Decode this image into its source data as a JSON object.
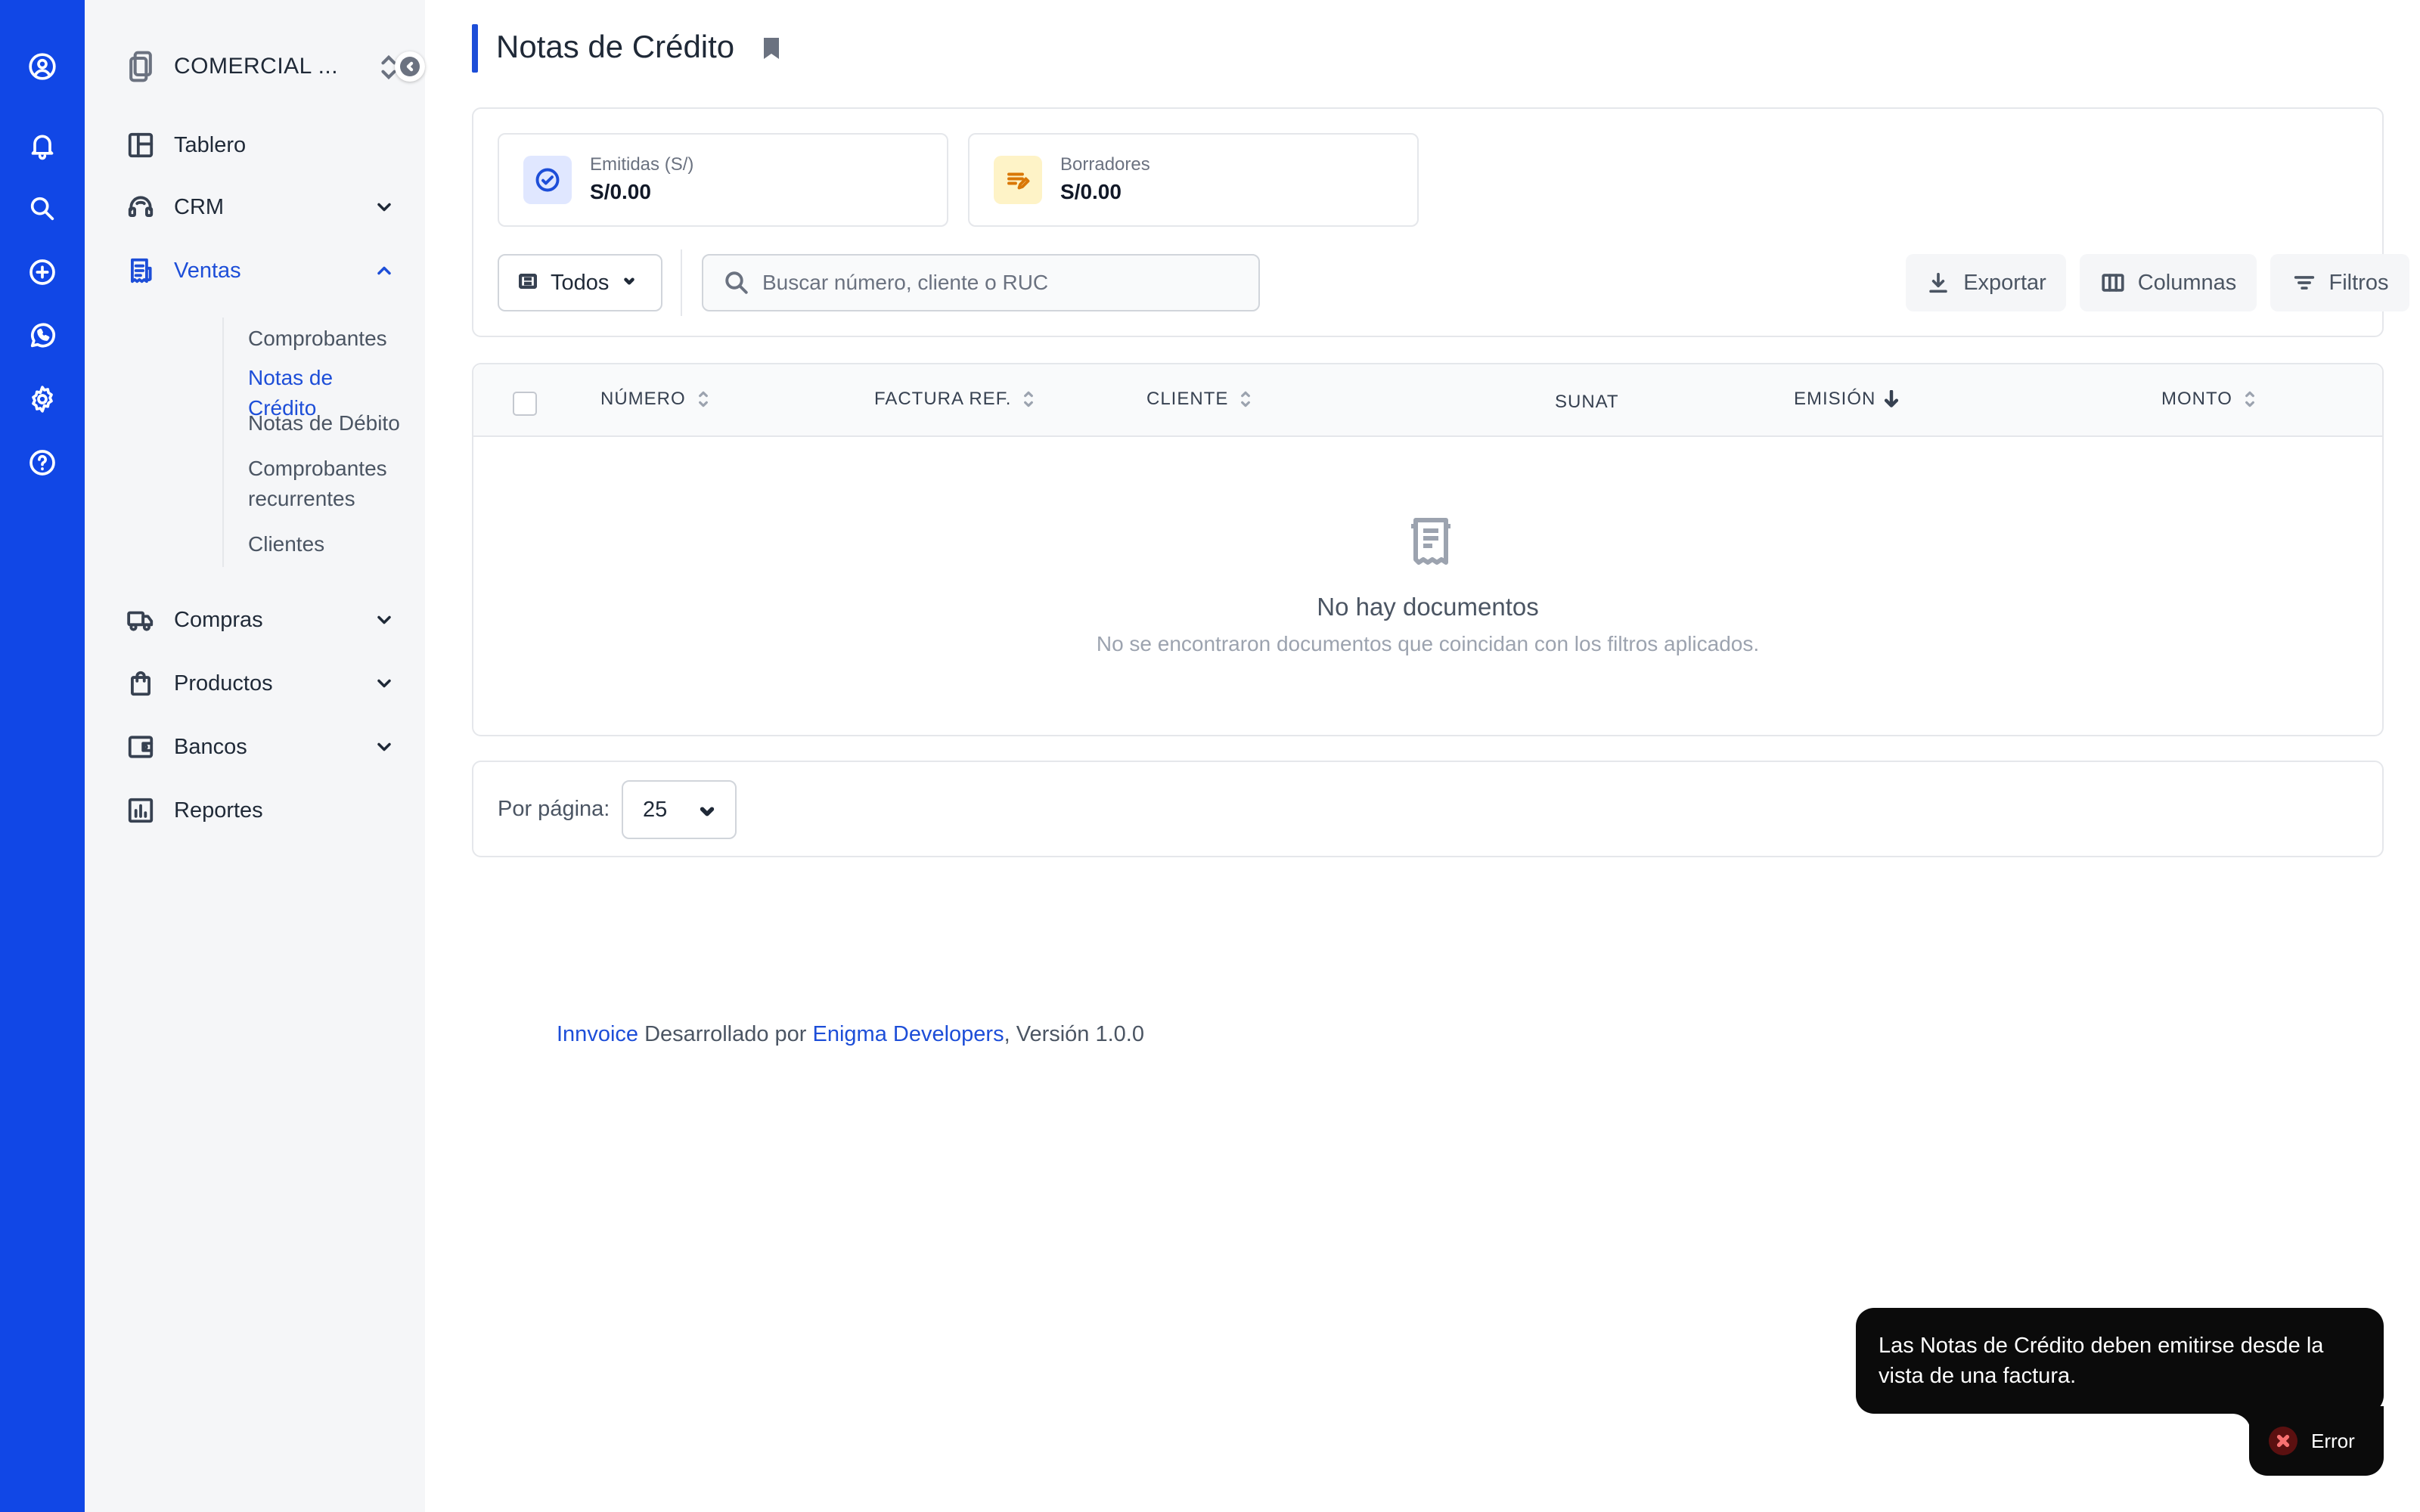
{
  "company": {
    "name": "COMERCIAL ..."
  },
  "nav": {
    "items": [
      {
        "label": "Tablero"
      },
      {
        "label": "CRM"
      },
      {
        "label": "Ventas"
      },
      {
        "label": "Compras"
      },
      {
        "label": "Productos"
      },
      {
        "label": "Bancos"
      },
      {
        "label": "Reportes"
      }
    ],
    "ventas_sub": [
      {
        "label": "Comprobantes"
      },
      {
        "label": "Notas de Crédito"
      },
      {
        "label": "Notas de Débito"
      },
      {
        "label": "Comprobantes recurrentes"
      },
      {
        "label": "Clientes"
      }
    ]
  },
  "page": {
    "title": "Notas de Crédito"
  },
  "stats": [
    {
      "label": "Emitidas (S/)",
      "value": "S/0.00"
    },
    {
      "label": "Borradores",
      "value": "S/0.00"
    }
  ],
  "filters": {
    "status_label": "Todos",
    "search_placeholder": "Buscar número, cliente o RUC",
    "export_label": "Exportar",
    "columns_label": "Columnas",
    "filters_label": "Filtros"
  },
  "table": {
    "headers": [
      "NÚMERO",
      "FACTURA REF.",
      "CLIENTE",
      "SUNAT",
      "EMISIÓN",
      "MONTO"
    ],
    "empty_title": "No hay documentos",
    "empty_subtitle": "No se encontraron documentos que coincidan con los filtros aplicados."
  },
  "pager": {
    "label": "Por página:",
    "value": "25"
  },
  "footer": {
    "brand": "Innvoice",
    "middle": " Desarrollado por ",
    "developer": "Enigma Developers",
    "version": ", Versión 1.0.0"
  },
  "toast": {
    "message": "Las Notas de Crédito deben emitirse desde la vista de una factura.",
    "type_label": "Error"
  },
  "colors": {
    "rail": "#1147e6",
    "accent": "#1d4ed8",
    "sidebar_bg": "#f5f6f8",
    "toast_bg": "#0b0b0b"
  }
}
